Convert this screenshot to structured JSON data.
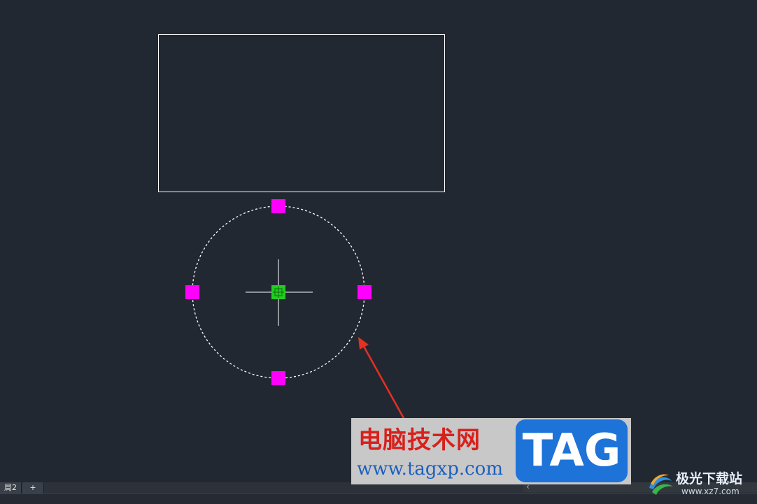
{
  "layout_tabs": [
    {
      "label": "局2"
    },
    {
      "label": "+"
    }
  ],
  "scrollbar": {
    "arrow": "‹"
  },
  "watermark_1": {
    "cn_text": "电脑技术网",
    "url": "www.tagxp.com",
    "tag": "TAG"
  },
  "watermark_2": {
    "cn_text": "极光下载站",
    "url": "www.xz7.com",
    "logo_icon": "aurora-swirl-logo-icon"
  },
  "colors": {
    "canvas_bg": "#222831",
    "grip_magenta": "#ff00ff",
    "grip_center_green": "#22cc22",
    "annotation_arrow": "#e53022",
    "geometry_white": "#ffffff"
  }
}
